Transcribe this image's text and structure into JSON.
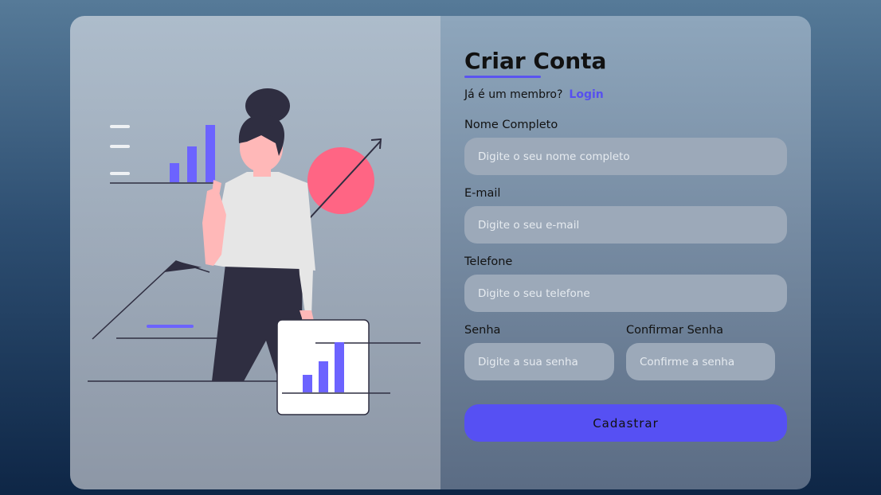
{
  "form": {
    "title": "Criar Conta",
    "member_text": "Já é um membro?",
    "login_link": "Login",
    "fields": {
      "name": {
        "label": "Nome Completo",
        "placeholder": "Digite o seu nome completo"
      },
      "email": {
        "label": "E-mail",
        "placeholder": "Digite o seu e-mail"
      },
      "phone": {
        "label": "Telefone",
        "placeholder": "Digite o seu telefone"
      },
      "password": {
        "label": "Senha",
        "placeholder": "Digite a sua senha"
      },
      "confirm": {
        "label": "Confirmar Senha",
        "placeholder": "Confirme a senha"
      }
    },
    "submit_label": "Cadastrar"
  },
  "colors": {
    "accent": "#5650f3",
    "illustration_accent": "#6c63ff",
    "illustration_pink": "#ff6584",
    "illustration_dark": "#2f2e41"
  },
  "illustration": {
    "name": "business-woman-growth-chart-illustration"
  }
}
